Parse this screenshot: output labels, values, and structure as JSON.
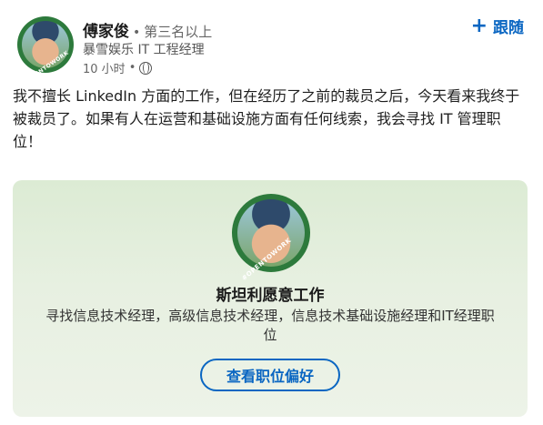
{
  "author": {
    "name": "傅家俊",
    "separator": "•",
    "degree": "第三名以上",
    "headline": "暴雪娱乐 IT 工程经理",
    "time": "10 小时",
    "time_separator": "•",
    "avatar_badge": "#OPENTOWORK",
    "visibility_icon": "globe-icon"
  },
  "follow": {
    "icon": "+",
    "label": "跟随"
  },
  "post": {
    "text": "我不擅长 LinkedIn 方面的工作，但在经历了之前的裁员之后，今天看来我终于被裁员了。如果有人在运营和基础设施方面有任何线索，我会寻找 IT 管理职位！"
  },
  "card": {
    "avatar_badge": "#OPENTOWORK",
    "title": "斯坦利愿意工作",
    "subtitle": "寻找信息技术经理，高级信息技术经理，信息技术基础设施经理和IT经理职位",
    "button_label": "查看职位偏好"
  },
  "colors": {
    "accent": "#0a66c2",
    "card_bg": "#e3eedb",
    "badge_green": "#2d7a3c"
  }
}
